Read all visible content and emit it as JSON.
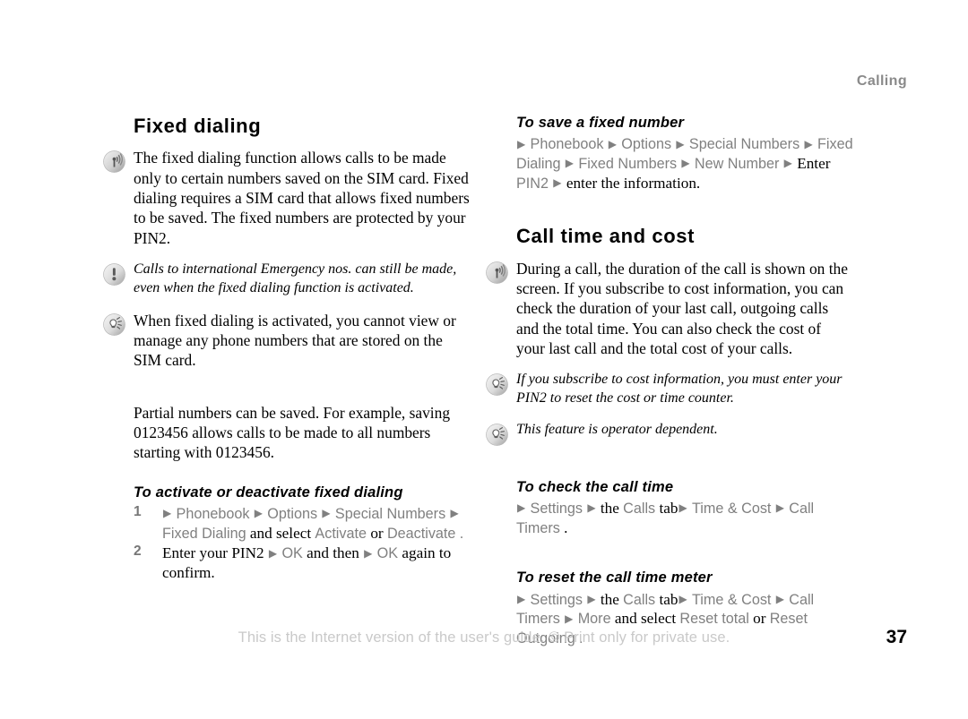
{
  "header": {
    "chapter": "Calling"
  },
  "left_column": {
    "title": "Fixed dialing",
    "intro": {
      "icon": "signal-waves-icon",
      "text": "The fixed dialing function allows calls to be made only to certain numbers saved on the SIM card. Fixed dialing requires a SIM card that allows fixed numbers to be saved. The fixed numbers are protected by your PIN2."
    },
    "warning_note": {
      "icon": "exclamation-icon",
      "text": "Calls to international Emergency nos. can still be made, even when the fixed dialing function is activated."
    },
    "tip_note": {
      "icon": "lightbulb-icon",
      "text": "When fixed dialing is activated, you cannot view or manage any phone numbers that are stored on the SIM card."
    },
    "partial_numbers": {
      "text": "Partial numbers can be saved. For example, saving 0123456 allows calls to be made to all numbers starting with 0123456."
    },
    "procedure": {
      "title": "To activate or deactivate fixed dialing",
      "steps": [
        {
          "number": "1",
          "segments": [
            {
              "type": "arrow"
            },
            {
              "type": "menu",
              "text": "Phonebook"
            },
            {
              "type": "arrow"
            },
            {
              "type": "menu",
              "text": "Options"
            },
            {
              "type": "arrow"
            },
            {
              "type": "menu",
              "text": "Special Numbers"
            },
            {
              "type": "arrow"
            },
            {
              "type": "menu",
              "text": "Fixed Dialing"
            },
            {
              "type": "plain",
              "text": " and select "
            },
            {
              "type": "menu",
              "text": "Activate"
            },
            {
              "type": "plain",
              "text": " or "
            },
            {
              "type": "menu",
              "text": "Deactivate"
            },
            {
              "type": "menu",
              "text": "."
            }
          ]
        },
        {
          "number": "2",
          "segments": [
            {
              "type": "plain",
              "text": "Enter your PIN2 "
            },
            {
              "type": "arrow"
            },
            {
              "type": "menu",
              "text": "OK"
            },
            {
              "type": "plain",
              "text": " and then "
            },
            {
              "type": "arrow"
            },
            {
              "type": "menu",
              "text": "OK"
            },
            {
              "type": "plain",
              "text": " again to confirm."
            }
          ]
        }
      ]
    }
  },
  "right_column": {
    "save_fixed_number": {
      "title": "To save a fixed number",
      "segments": [
        {
          "type": "arrow"
        },
        {
          "type": "menu",
          "text": "Phonebook"
        },
        {
          "type": "arrow"
        },
        {
          "type": "menu",
          "text": "Options"
        },
        {
          "type": "arrow"
        },
        {
          "type": "menu",
          "text": "Special Numbers"
        },
        {
          "type": "arrow"
        },
        {
          "type": "menu",
          "text": "Fixed Dialing"
        },
        {
          "type": "arrow"
        },
        {
          "type": "menu",
          "text": "Fixed Numbers"
        },
        {
          "type": "arrow"
        },
        {
          "type": "menu",
          "text": "New Number"
        },
        {
          "type": "arrow"
        },
        {
          "type": "plain",
          "text": "Enter "
        },
        {
          "type": "menu",
          "text": "PIN2"
        },
        {
          "type": "arrow"
        },
        {
          "type": "plain",
          "text": "enter the information."
        }
      ]
    },
    "title": "Call time and cost",
    "intro": {
      "icon": "signal-waves-icon",
      "text": "During a call, the duration of the call is shown on the screen. If you subscribe to cost information, you can check the duration of your last call, outgoing calls and the total time. You can also check the cost of your last call and the total cost of your calls."
    },
    "tip_note_1": {
      "icon": "lightbulb-icon",
      "text": "If you subscribe to cost information, you must enter your PIN2 to reset the cost or time counter."
    },
    "tip_note_2": {
      "icon": "lightbulb-icon",
      "text": "This feature is operator dependent."
    },
    "check_call_time": {
      "title": "To check the call time",
      "segments": [
        {
          "type": "arrow"
        },
        {
          "type": "menu",
          "text": "Settings"
        },
        {
          "type": "arrow"
        },
        {
          "type": "plain",
          "text": "the "
        },
        {
          "type": "menu",
          "text": "Calls"
        },
        {
          "type": "plain",
          "text": " tab"
        },
        {
          "type": "arrow"
        },
        {
          "type": "menu",
          "text": "Time & Cost"
        },
        {
          "type": "arrow"
        },
        {
          "type": "menu",
          "text": "Call Timers"
        },
        {
          "type": "plain",
          "text": "."
        }
      ]
    },
    "reset_call_time_meter": {
      "title": "To reset the call time meter",
      "segments": [
        {
          "type": "arrow"
        },
        {
          "type": "menu",
          "text": "Settings"
        },
        {
          "type": "arrow"
        },
        {
          "type": "plain",
          "text": "the "
        },
        {
          "type": "menu",
          "text": "Calls"
        },
        {
          "type": "plain",
          "text": " tab"
        },
        {
          "type": "arrow"
        },
        {
          "type": "menu",
          "text": "Time & Cost"
        },
        {
          "type": "arrow"
        },
        {
          "type": "menu",
          "text": "Call Timers"
        },
        {
          "type": "arrow"
        },
        {
          "type": "menu",
          "text": "More"
        },
        {
          "type": "plain",
          "text": " and select "
        },
        {
          "type": "menu",
          "text": "Reset total"
        },
        {
          "type": "plain",
          "text": " or "
        },
        {
          "type": "menu",
          "text": "Reset Outgoing"
        },
        {
          "type": "menu",
          "text": "."
        }
      ]
    }
  },
  "footer": {
    "notice": "This is the Internet version of the user's guide. © Print only for private use.",
    "page_number": "37"
  },
  "colors": {
    "menu_term": "#808080",
    "header_chapter": "#8a8a8a",
    "footer_notice": "#c9c9c9",
    "body_text": "#000000"
  }
}
